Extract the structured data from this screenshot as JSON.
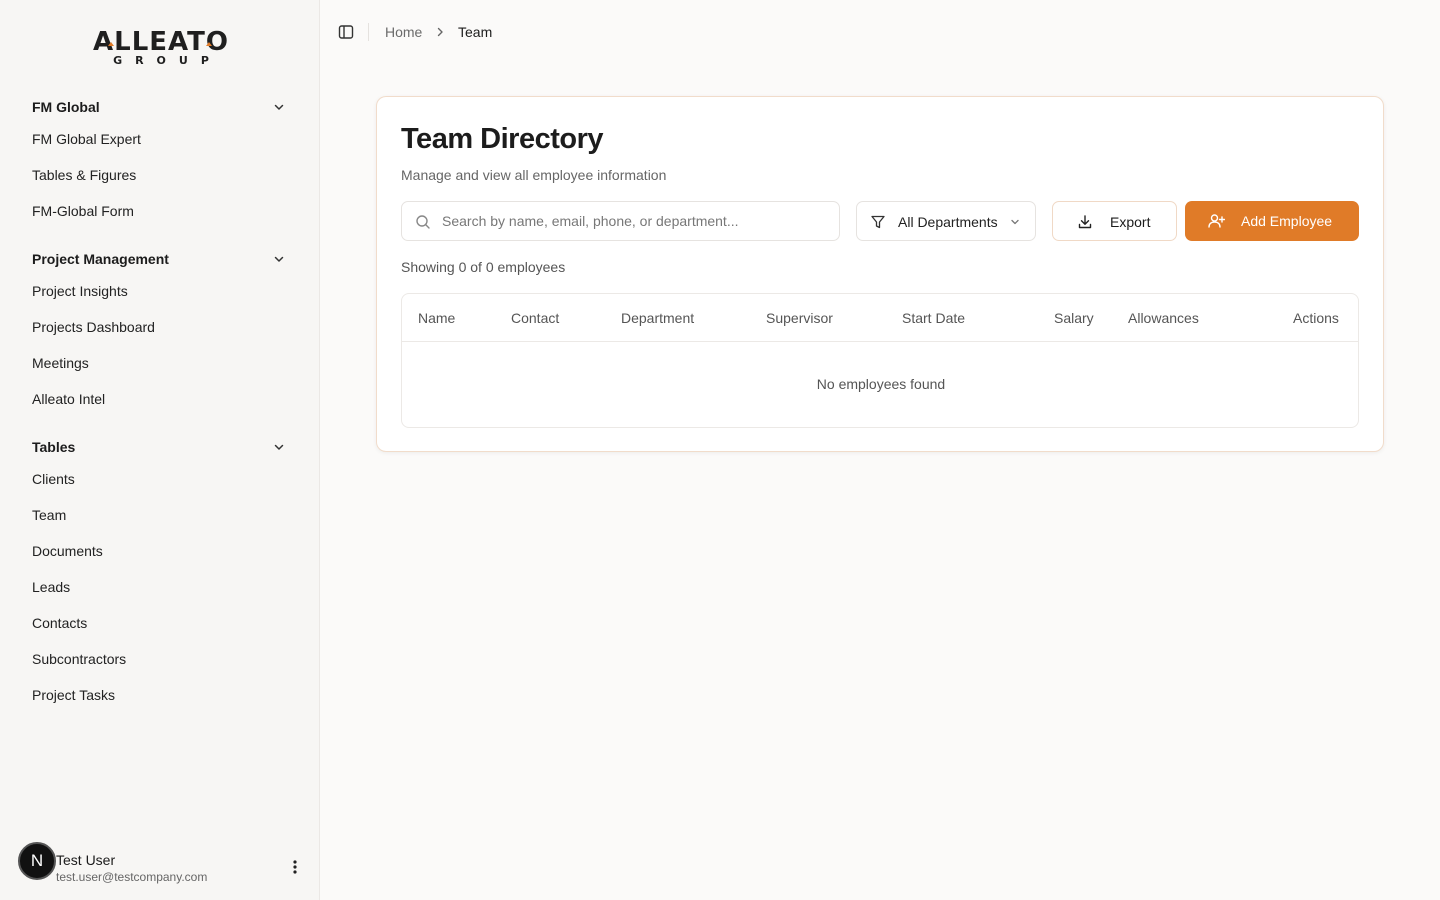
{
  "brand": {
    "name": "ALLEATO",
    "sub": "GROUP",
    "accent": "#e07b28"
  },
  "sidebar": {
    "groups": [
      {
        "title": "FM Global",
        "items": [
          "FM Global Expert",
          "Tables & Figures",
          "FM-Global Form"
        ]
      },
      {
        "title": "Project Management",
        "items": [
          "Project Insights",
          "Projects Dashboard",
          "Meetings",
          "Alleato Intel"
        ]
      },
      {
        "title": "Tables",
        "items": [
          "Clients",
          "Team",
          "Documents",
          "Leads",
          "Contacts",
          "Subcontractors",
          "Project Tasks"
        ]
      }
    ]
  },
  "user": {
    "initial": "N",
    "name": "Test User",
    "email": "test.user@testcompany.com"
  },
  "breadcrumb": {
    "home": "Home",
    "current": "Team"
  },
  "page": {
    "title": "Team Directory",
    "subtitle": "Manage and view all employee information",
    "search_placeholder": "Search by name, email, phone, or department...",
    "department_filter": "All Departments",
    "export_label": "Export",
    "add_label": "Add Employee",
    "showing": "Showing 0 of 0 employees"
  },
  "table": {
    "columns": [
      "Name",
      "Contact",
      "Department",
      "Supervisor",
      "Start Date",
      "Salary",
      "Allowances",
      "Actions"
    ],
    "empty_message": "No employees found"
  },
  "icons": {
    "sidebar_toggle": "sidebar-toggle-icon",
    "breadcrumb_separator": "chevron-right-icon",
    "search": "search-icon",
    "filter": "filter-icon",
    "dropdown": "chevron-down-icon",
    "export": "download-icon",
    "add": "user-plus-icon",
    "user_menu": "more-vertical-icon"
  }
}
